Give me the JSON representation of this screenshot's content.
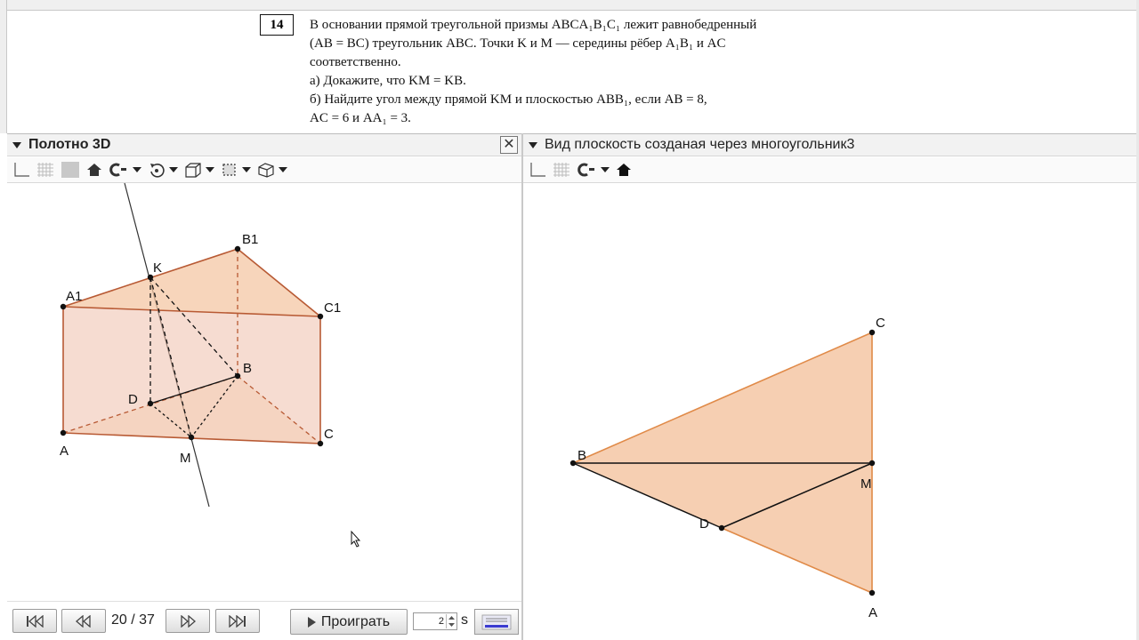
{
  "problem": {
    "number": "14",
    "lines": [
      "В основании прямой треугольной призмы ABCA₁B₁C₁ лежит равнобедренный",
      "(AB = BC) треугольник ABC. Точки K и M — середины рёбер A₁B₁ и AC",
      "соответственно.",
      "а) Докажите, что KM = KB.",
      "б) Найдите угол между прямой KM и плоскостью ABB₁, если AB = 8,",
      "AC = 6 и AA₁ = 3."
    ]
  },
  "left_panel": {
    "title": "Полотно 3D",
    "close_glyph": "✕"
  },
  "right_panel": {
    "title": "Вид плоскость созданая через многоугольник3"
  },
  "points_3d": {
    "A1": "A1",
    "B1": "B1",
    "C1": "C1",
    "K": "K",
    "B": "B",
    "D": "D",
    "A": "A",
    "M": "M",
    "C": "C"
  },
  "points_2d": {
    "C": "C",
    "B": "B",
    "M": "M",
    "D": "D",
    "A": "A"
  },
  "playback": {
    "counter": "20 / 37",
    "play_label": "Проиграть",
    "speed_value": "2",
    "speed_unit": "s"
  },
  "colors": {
    "fill": "#f4c7a4",
    "edge": "#d26a3a",
    "line": "#111111"
  }
}
